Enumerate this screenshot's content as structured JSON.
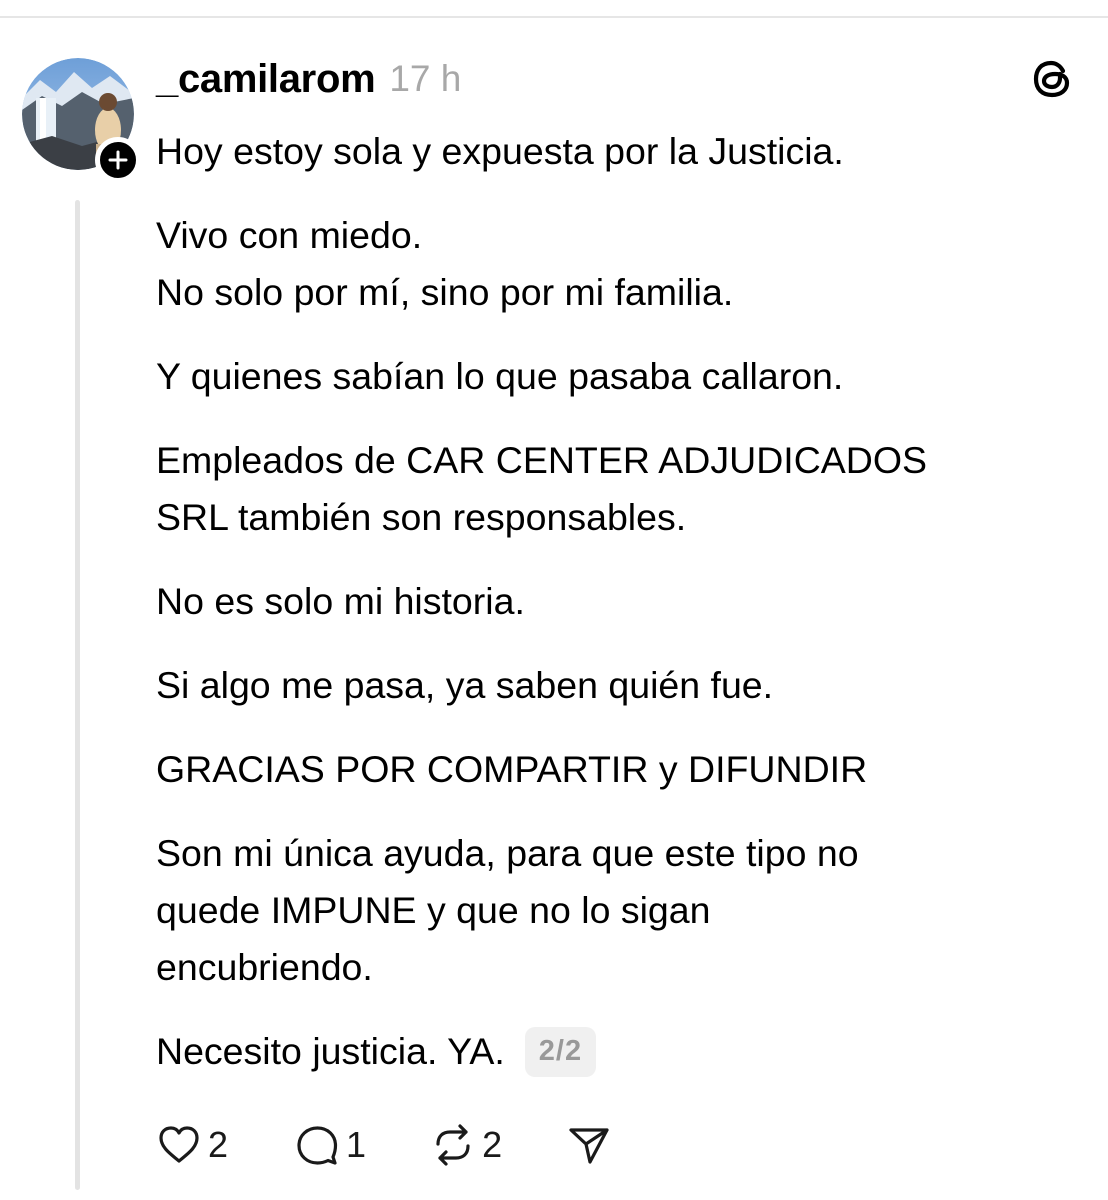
{
  "post": {
    "username": "_camilarom",
    "timestamp": "17 h",
    "paragraphs": [
      "Hoy estoy sola y expuesta por la Justicia.",
      "Vivo con miedo.",
      "No solo por mí, sino por mi familia.",
      "Y quienes sabían lo que pasaba callaron.",
      "Empleados de CAR CENTER ADJUDICADOS",
      "SRL también son responsables.",
      "No es solo mi historia.",
      "Si algo me pasa, ya saben quién fue.",
      "GRACIAS POR COMPARTIR y DIFUNDIR",
      "Son mi única ayuda, para que este tipo no",
      "quede IMPUNE y que no lo sigan",
      "encubriendo.",
      "Necesito justicia. YA."
    ],
    "thread_position": "2/2"
  },
  "actions": {
    "likes": "2",
    "replies": "1",
    "reposts": "2"
  },
  "icons": {
    "follow": "plus-icon",
    "app": "threads-logo-icon",
    "like": "heart-icon",
    "reply": "comment-icon",
    "repost": "repost-icon",
    "share": "send-icon"
  }
}
